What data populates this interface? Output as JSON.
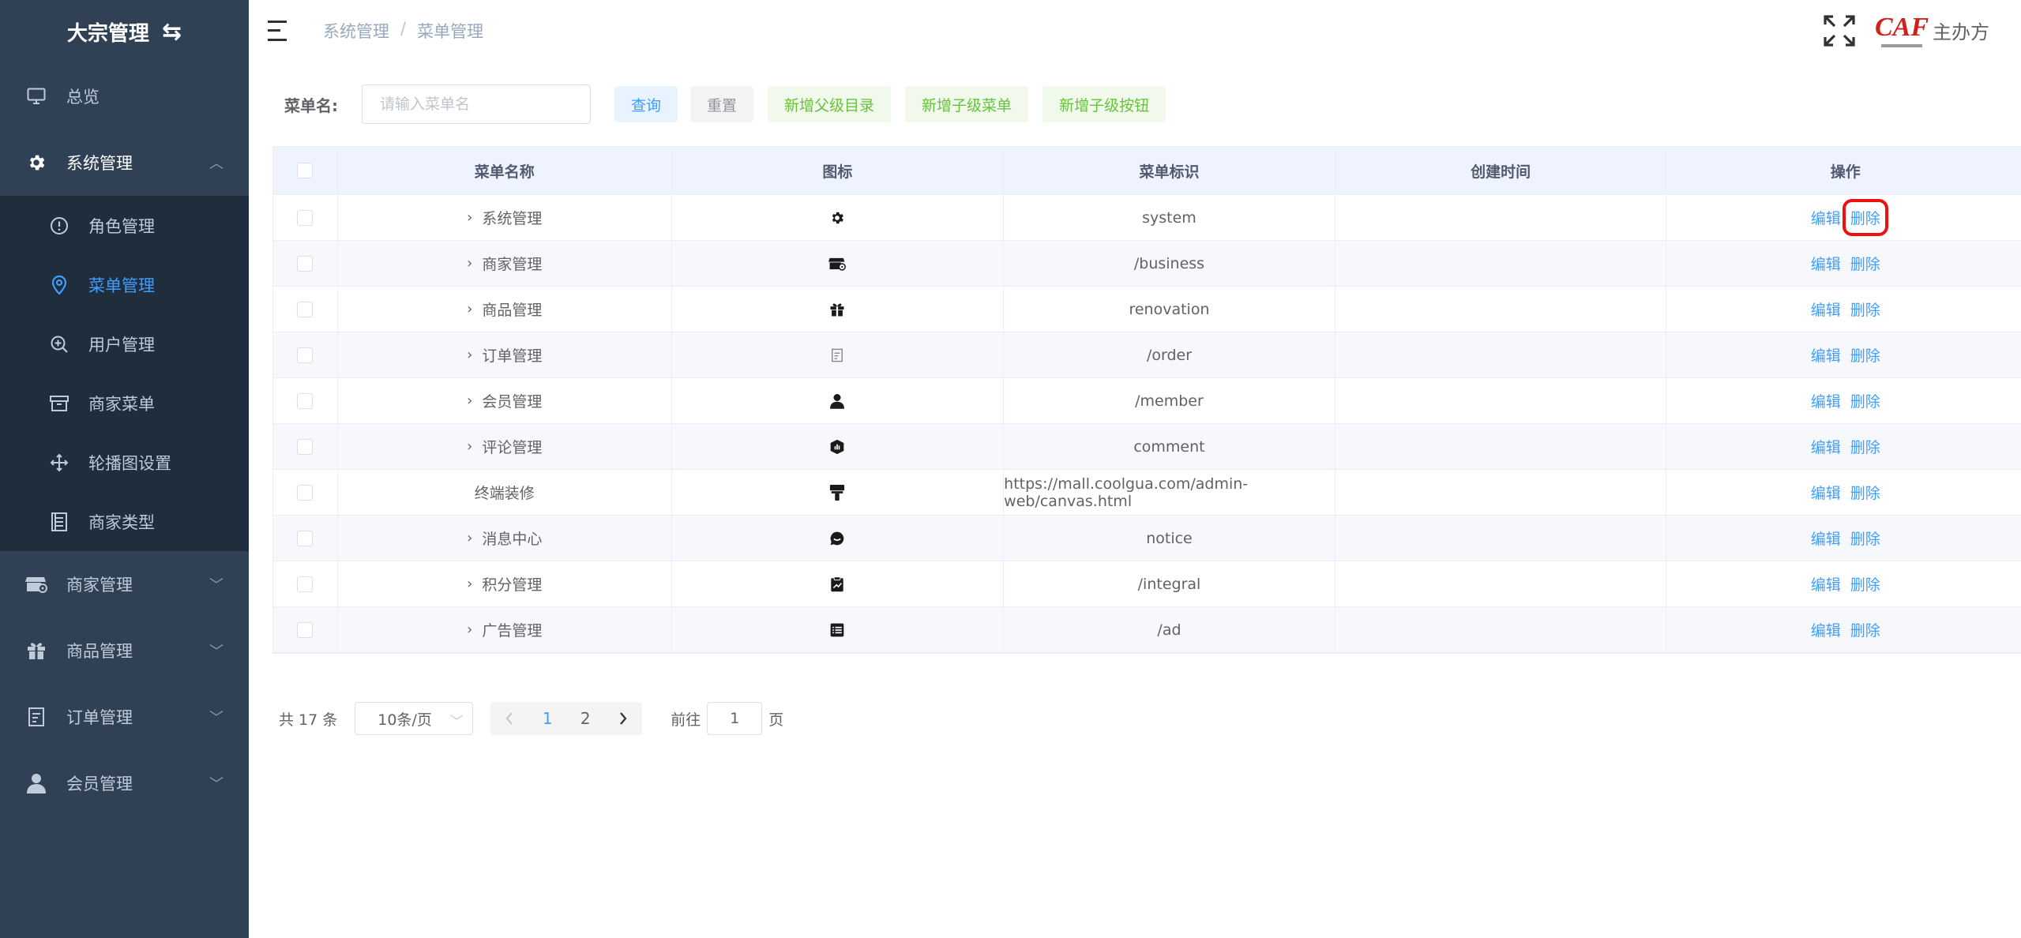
{
  "app": {
    "title": "大宗管理"
  },
  "sidebar": {
    "items": [
      {
        "label": "总览",
        "icon": "monitor-icon"
      },
      {
        "label": "系统管理",
        "icon": "gear-icon",
        "open": true,
        "children": [
          {
            "label": "角色管理",
            "icon": "alert-circle-icon"
          },
          {
            "label": "菜单管理",
            "icon": "location-icon",
            "active": true
          },
          {
            "label": "用户管理",
            "icon": "zoom-in-icon"
          },
          {
            "label": "商家菜单",
            "icon": "box-icon"
          },
          {
            "label": "轮播图设置",
            "icon": "move-icon"
          },
          {
            "label": "商家类型",
            "icon": "document-icon"
          }
        ]
      },
      {
        "label": "商家管理",
        "icon": "shop-icon"
      },
      {
        "label": "商品管理",
        "icon": "gift-icon"
      },
      {
        "label": "订单管理",
        "icon": "order-icon"
      },
      {
        "label": "会员管理",
        "icon": "user-icon"
      }
    ]
  },
  "header": {
    "breadcrumb": [
      "系统管理",
      "菜单管理"
    ],
    "org_name": "主办方",
    "logo_text": "CAF"
  },
  "search": {
    "label": "菜单名:",
    "placeholder": "请输入菜单名",
    "value": "",
    "buttons": {
      "query": "查询",
      "reset": "重置",
      "add_parent": "新增父级目录",
      "add_child_menu": "新增子级菜单",
      "add_child_button": "新增子级按钮"
    }
  },
  "table": {
    "headers": [
      "菜单名称",
      "图标",
      "菜单标识",
      "创建时间",
      "操作"
    ],
    "rows": [
      {
        "name": "系统管理",
        "icon": "gear-icon",
        "key": "system",
        "created": "",
        "expandable": true
      },
      {
        "name": "商家管理",
        "icon": "shop-icon",
        "key": "/business",
        "created": "",
        "expandable": true
      },
      {
        "name": "商品管理",
        "icon": "gift-icon",
        "key": "renovation",
        "created": "",
        "expandable": true
      },
      {
        "name": "订单管理",
        "icon": "order-icon",
        "key": "/order",
        "created": "",
        "expandable": true
      },
      {
        "name": "会员管理",
        "icon": "user-icon",
        "key": "/member",
        "created": "",
        "expandable": true
      },
      {
        "name": "评论管理",
        "icon": "comment-icon",
        "key": "comment",
        "created": "",
        "expandable": true
      },
      {
        "name": "终端装修",
        "icon": "paint-roller-icon",
        "key": "https://mall.coolgua.com/admin-web/canvas.html",
        "created": "",
        "expandable": false
      },
      {
        "name": "消息中心",
        "icon": "message-icon",
        "key": "notice",
        "created": "",
        "expandable": true
      },
      {
        "name": "积分管理",
        "icon": "chart-clipboard-icon",
        "key": "/integral",
        "created": "",
        "expandable": true
      },
      {
        "name": "广告管理",
        "icon": "list-icon",
        "key": "/ad",
        "created": "",
        "expandable": true
      }
    ],
    "actions": {
      "edit": "编辑",
      "delete": "删除"
    }
  },
  "pagination": {
    "total_text": "共 17 条",
    "page_size": "10条/页",
    "pages": [
      "1",
      "2"
    ],
    "current": "1",
    "goto_label": "前往",
    "goto_value": "1",
    "page_suffix": "页"
  },
  "colors": {
    "sidebar_bg": "#304156",
    "submenu_bg": "#1f2d3d",
    "primary": "#409eff",
    "success": "#67c23a",
    "highlight": "#ee1111"
  }
}
